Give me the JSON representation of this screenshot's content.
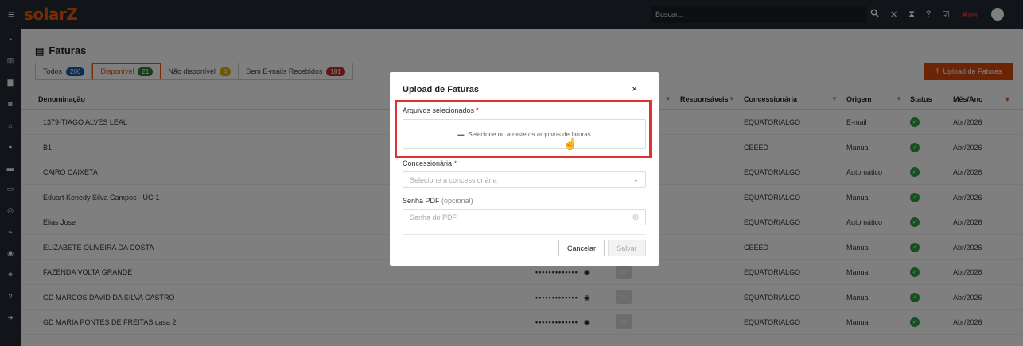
{
  "app": {
    "logo": "solarZ"
  },
  "topbar": {
    "hamburger_icon": "≡",
    "search_placeholder": "Buscar...",
    "icons": [
      "search-icon",
      "tools-icon",
      "hourglass-icon",
      "help-icon",
      "checklist-icon",
      "tools-alert-icon"
    ],
    "alert_percent": "0%"
  },
  "sidebar": {
    "icons": [
      "◔",
      "▥",
      "▆",
      "◙",
      "⌂",
      "●",
      "▬",
      "▭",
      "◎",
      "⌁",
      "◉",
      "✷",
      "?",
      "➔"
    ]
  },
  "page": {
    "title": "Faturas",
    "tabs": [
      {
        "label": "Todos",
        "count": "206",
        "color": "#1c5aa8"
      },
      {
        "label": "Disponível",
        "count": "21",
        "color": "#2f7d32"
      },
      {
        "label": "Não disponível",
        "count": "4",
        "color": "#e0b000"
      },
      {
        "label": "Sem E-mails Recebidos",
        "count": "181",
        "color": "#c92a2a"
      }
    ],
    "upload_button": "Upload de Faturas"
  },
  "table": {
    "headers": {
      "denominacao": "Denominação",
      "responsaveis": "Responsáveis",
      "concessionaria": "Concessionária",
      "origem": "Origem",
      "status": "Status",
      "mes_ano": "Mês/Ano"
    },
    "rows": [
      {
        "name": "1379-TIAGO ALVES LEAL",
        "conc": "EQUATORIALGO",
        "origem": "E-mail",
        "mes": "Abr/2026"
      },
      {
        "name": "B1",
        "conc": "CEEED",
        "origem": "Manual",
        "mes": "Abr/2026"
      },
      {
        "name": "CAIRO CAIXETA",
        "conc": "EQUATORIALGO",
        "origem": "Automático",
        "mes": "Abr/2026"
      },
      {
        "name": "Eduart Kenedy Silva Campos - UC-1",
        "conc": "EQUATORIALGO",
        "origem": "Manual",
        "mes": "Abr/2026"
      },
      {
        "name": "Elias Jose",
        "conc": "EQUATORIALGO",
        "origem": "Automático",
        "mes": "Abr/2026"
      },
      {
        "name": "ELIZABETE OLIVEIRA DA COSTA",
        "conc": "CEEED",
        "origem": "Manual",
        "mes": "Abr/2026"
      },
      {
        "name": "FAZENDA VOLTA GRANDE",
        "conc": "EQUATORIALGO",
        "origem": "Manual",
        "mes": "Abr/2026",
        "pw": "•••••••••••••"
      },
      {
        "name": "GD MARCOS DAVID DA SILVA CASTRO",
        "conc": "EQUATORIALGO",
        "origem": "Manual",
        "mes": "Abr/2026",
        "pw": "•••••••••••••"
      },
      {
        "name": "GD MARIA PONTES DE FREITAS casa 2",
        "conc": "EQUATORIALGO",
        "origem": "Manual",
        "mes": "Abr/2026",
        "pw": "•••••••••••••"
      }
    ]
  },
  "modal": {
    "title": "Upload de Faturas",
    "close": "×",
    "files_label": "Arquivos selecionados",
    "dropzone_text": "Selecione ou arraste os arquivos de faturas",
    "concessionaria_label": "Concessionária",
    "concessionaria_placeholder": "Selecione a concessionária",
    "senha_label": "Senha PDF",
    "senha_optional": "(opcional)",
    "senha_placeholder": "Senha do PDF",
    "required_mark": "*",
    "cancel_button": "Cancelar",
    "save_button": "Salvar"
  },
  "colors": {
    "accent": "#d9480f",
    "highlight": "#e03131",
    "status_ok": "#2f9e44"
  }
}
